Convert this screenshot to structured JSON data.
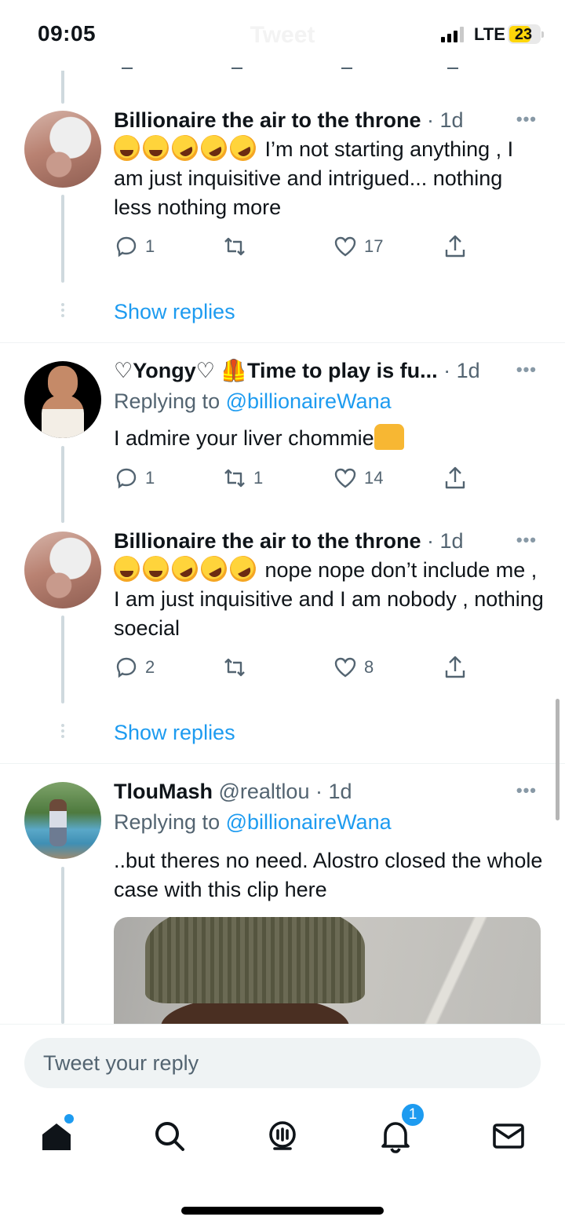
{
  "status_bar": {
    "time": "09:05",
    "network": "LTE",
    "battery": "23",
    "header_title": "Tweet"
  },
  "tweets": [
    {
      "name": "Billionaire the air to the throne",
      "meta": " · 1d",
      "text": "I’m not starting anything , I am just inquisitive and intrigued... nothing less nothing more",
      "emoji": "laughing-emoji x2, rofl-emoji x3",
      "replies": "1",
      "retweets": "",
      "likes": "17",
      "show_replies": "Show replies"
    },
    {
      "name": "♡Yongy♡ 🦺Time to play is fu...",
      "meta": " · 1d",
      "replying_prefix": "Replying to ",
      "replying_handle": "@billionaireWana",
      "text": "I admire your liver chommie",
      "emoji": "raising-hands-emoji",
      "replies": "1",
      "retweets": "1",
      "likes": "14"
    },
    {
      "name": "Billionaire the air to the throne",
      "meta": " · 1d",
      "text": "nope nope don’t include me , I am just inquisitive and I am nobody , nothing soecial",
      "emoji": "laughing-emoji x2, rofl-emoji x3",
      "replies": "2",
      "retweets": "",
      "likes": "8",
      "show_replies": "Show replies"
    },
    {
      "name": "TlouMash",
      "handle": " @realtlou",
      "meta": " · 1d",
      "replying_prefix": "Replying to ",
      "replying_handle": "@billionaireWana",
      "text": "..but theres no need. Alostro closed the whole case with this clip here"
    }
  ],
  "reply_box": {
    "placeholder": "Tweet your reply"
  },
  "tab_bar": {
    "items": [
      "home-icon",
      "search-icon",
      "spaces-icon",
      "notifications-icon",
      "messages-icon"
    ],
    "notification_count": "1"
  },
  "colors": {
    "accent": "#1d9bf0",
    "text": "#0f1419",
    "muted": "#536471",
    "line": "#cfd9de"
  }
}
